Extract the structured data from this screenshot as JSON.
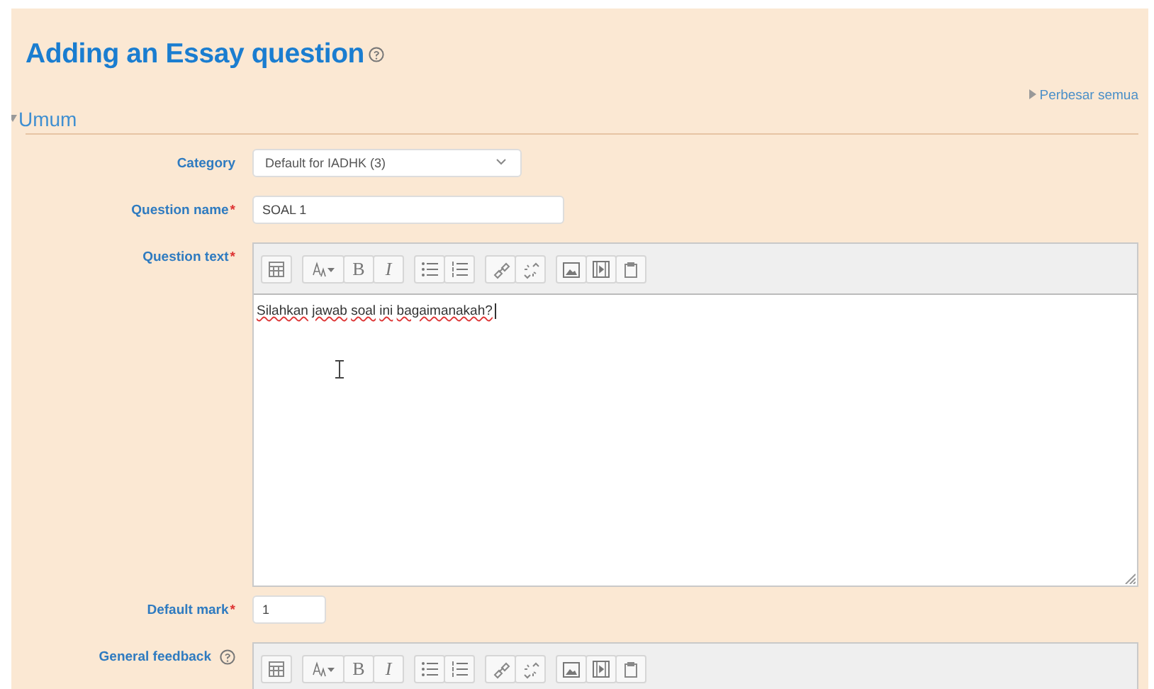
{
  "page": {
    "title": "Adding an Essay question",
    "title_help": true,
    "expand_all": "Perbesar semua"
  },
  "section": {
    "title": "Umum",
    "expanded": true
  },
  "fields": [
    {
      "kind": "select",
      "label": "Category",
      "value": "Default for IADHK (3)"
    },
    {
      "kind": "text",
      "label": "Question name",
      "required_mark": "*",
      "value": "SOAL 1"
    },
    {
      "kind": "editor",
      "label": "Question text",
      "required_mark": "*",
      "content": [
        {
          "text": "Silahkan",
          "misspelled": true
        },
        {
          "text": "jawab",
          "misspelled": true
        },
        {
          "text": "soal",
          "misspelled": true
        },
        {
          "text": "ini",
          "misspelled": true
        },
        {
          "text": "bagaimanakah?",
          "misspelled": true
        }
      ],
      "toolbar": [
        [
          {
            "kind": "table"
          }
        ],
        [
          {
            "kind": "fontsize"
          },
          {
            "kind": "bold",
            "label": "B"
          },
          {
            "kind": "italic",
            "label": "I"
          }
        ],
        [
          {
            "kind": "ul"
          },
          {
            "kind": "ol"
          }
        ],
        [
          {
            "kind": "link"
          },
          {
            "kind": "unlink"
          }
        ],
        [
          {
            "kind": "image"
          },
          {
            "kind": "media"
          },
          {
            "kind": "paste"
          }
        ]
      ]
    },
    {
      "kind": "short",
      "label": "Default mark",
      "required_mark": "*",
      "value": "1"
    },
    {
      "kind": "editor",
      "label": "General feedback",
      "help": true,
      "toolbar": [
        [
          {
            "kind": "table"
          }
        ],
        [
          {
            "kind": "fontsize"
          },
          {
            "kind": "bold",
            "label": "B"
          },
          {
            "kind": "italic",
            "label": "I"
          }
        ],
        [
          {
            "kind": "ul"
          },
          {
            "kind": "ol"
          }
        ],
        [
          {
            "kind": "link"
          },
          {
            "kind": "unlink"
          }
        ],
        [
          {
            "kind": "image"
          },
          {
            "kind": "media"
          },
          {
            "kind": "paste"
          }
        ]
      ]
    }
  ]
}
